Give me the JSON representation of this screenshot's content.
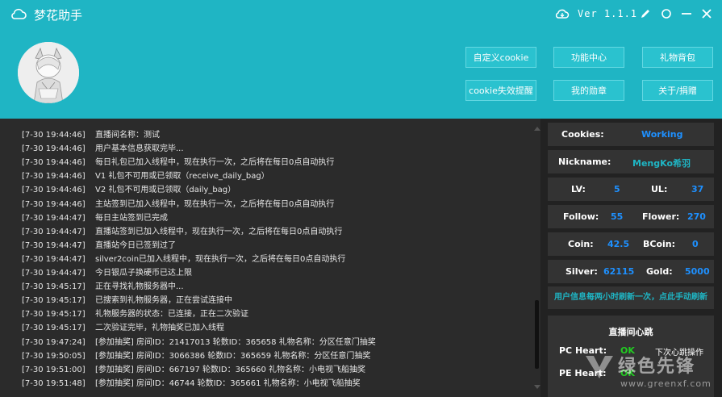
{
  "app": {
    "title": "梦花助手",
    "version": "Ver 1.1.1"
  },
  "header_buttons": [
    {
      "label": "自定义cookie"
    },
    {
      "label": "功能中心"
    },
    {
      "label": "礼物背包"
    },
    {
      "label": "cookie失效提醒"
    },
    {
      "label": "我的勋章"
    },
    {
      "label": "关于/捐赠"
    }
  ],
  "log": [
    {
      "time": "[7-30 19:44:46]",
      "text": "直播间名称：测试"
    },
    {
      "time": "[7-30 19:44:46]",
      "text": "用户基本信息获取完毕..."
    },
    {
      "time": "[7-30 19:44:46]",
      "text": "每日礼包已加入线程中，现在执行一次，之后将在每日0点自动执行"
    },
    {
      "time": "[7-30 19:44:46]",
      "text": "V1 礼包不可用或已领取（receive_daily_bag）"
    },
    {
      "time": "[7-30 19:44:46]",
      "text": "V2 礼包不可用或已领取（daily_bag）"
    },
    {
      "time": "[7-30 19:44:46]",
      "text": "主站签到已加入线程中，现在执行一次，之后将在每日0点自动执行"
    },
    {
      "time": "[7-30 19:44:47]",
      "text": "每日主站签到已完成"
    },
    {
      "time": "[7-30 19:44:47]",
      "text": "直播站签到已加入线程中，现在执行一次，之后将在每日0点自动执行"
    },
    {
      "time": "[7-30 19:44:47]",
      "text": "直播站今日已签到过了"
    },
    {
      "time": "[7-30 19:44:47]",
      "text": "silver2coin已加入线程中，现在执行一次，之后将在每日0点自动执行"
    },
    {
      "time": "[7-30 19:44:47]",
      "text": "今日银瓜子换硬币已达上限"
    },
    {
      "time": "[7-30 19:45:17]",
      "text": "正在寻找礼物服务器中..."
    },
    {
      "time": "[7-30 19:45:17]",
      "text": "已搜索到礼物服务器，正在尝试连接中"
    },
    {
      "time": "[7-30 19:45:17]",
      "text": "礼物服务器的状态：已连接，正在二次验证"
    },
    {
      "time": "[7-30 19:45:17]",
      "text": "二次验证完毕，礼物抽奖已加入线程"
    },
    {
      "time": "[7-30 19:47:24]",
      "text": "[参加抽奖] 房间ID：21417013 轮数ID：365658 礼物名称：分区任意门抽奖"
    },
    {
      "time": "[7-30 19:50:05]",
      "text": "[参加抽奖] 房间ID：3066386 轮数ID：365659 礼物名称：分区任意门抽奖"
    },
    {
      "time": "[7-30 19:51:00]",
      "text": "[参加抽奖] 房间ID：667197 轮数ID：365660 礼物名称：小电视飞船抽奖"
    },
    {
      "time": "[7-30 19:51:48]",
      "text": "[参加抽奖] 房间ID：46744 轮数ID：365661 礼物名称：小电视飞船抽奖"
    }
  ],
  "info": {
    "cookies_label": "Cookies:",
    "cookies_value": "Working",
    "nickname_label": "Nickname:",
    "nickname_value": "MengKo希羽",
    "lv_label": "LV:",
    "lv_value": "5",
    "ul_label": "UL:",
    "ul_value": "37",
    "follow_label": "Follow:",
    "follow_value": "55",
    "flower_label": "Flower:",
    "flower_value": "270",
    "coin_label": "Coin:",
    "coin_value": "42.5",
    "bcoin_label": "BCoin:",
    "bcoin_value": "0",
    "silver_label": "Silver:",
    "silver_value": "62115",
    "gold_label": "Gold:",
    "gold_value": "5000",
    "refresh_text": "用户信息每两小时刷新一次，点此手动刷新"
  },
  "heartbeat": {
    "title": "直播间心跳",
    "pc_label": "PC Heart:",
    "pc_status": "OK",
    "pe_label": "PE Heart:",
    "pe_status": "OK",
    "next_text": "下次心跳操作"
  },
  "watermark": {
    "text": "绿色先锋",
    "url": "www.greenxf.com"
  },
  "colors": {
    "accent": "#1fb5c4",
    "value_blue": "#1e90ff",
    "ok_green": "#22cc22",
    "log_bg": "#2b2b2b",
    "panel_bg": "#222222"
  }
}
